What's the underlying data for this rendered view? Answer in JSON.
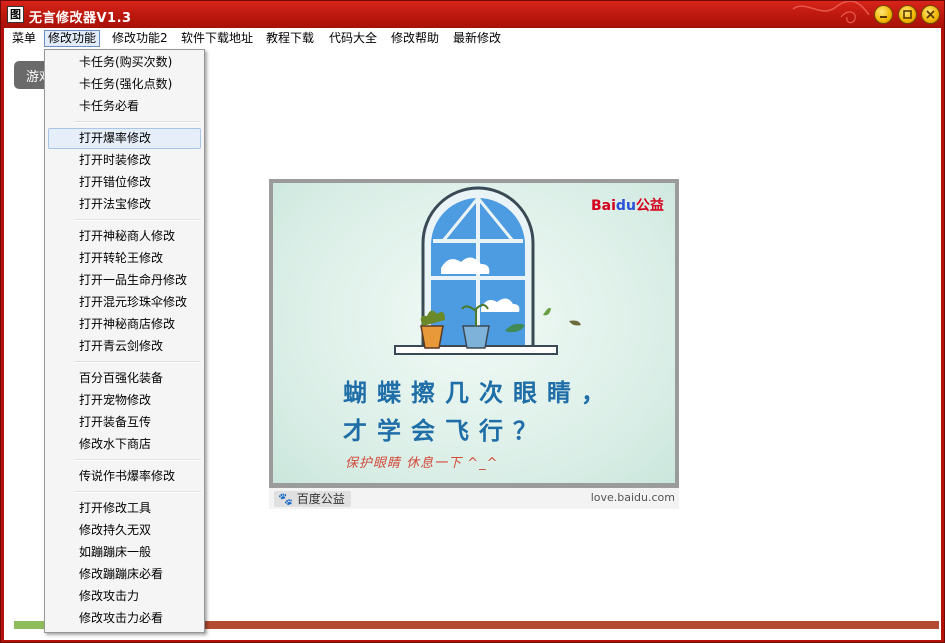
{
  "window": {
    "title": "无言修改器V1.3",
    "icon": "app-glyph-icon",
    "icon_glyph": "图"
  },
  "menubar": {
    "items": [
      "菜单",
      "修改功能",
      "修改功能2",
      "软件下载地址",
      "教程下载",
      "代码大全",
      "修改帮助",
      "最新修改"
    ],
    "active_index": 1
  },
  "background_tab": {
    "label": "游戏"
  },
  "dropdown": {
    "hover_index": 3,
    "items": [
      "卡任务(购买次数)",
      "卡任务(强化点数)",
      "卡任务必看",
      "打开爆率修改",
      "打开时装修改",
      "打开错位修改",
      "打开法宝修改",
      "打开神秘商人修改",
      "打开转轮王修改",
      "打开一品生命丹修改",
      "打开混元珍珠伞修改",
      "打开神秘商店修改",
      "打开青云剑修改",
      "百分百强化装备",
      "打开宠物修改",
      "打开装备互传",
      "修改水下商店",
      "传说作书爆率修改",
      "打开修改工具",
      "修改持久无双",
      "如蹦蹦床一般",
      "修改蹦蹦床必看",
      "修改攻击力",
      "修改攻击力必看"
    ]
  },
  "ad": {
    "brand": "Bai",
    "brand_paw": "du",
    "brand_suffix": "公益",
    "headline_1": "蝴蝶擦几次眼睛，",
    "headline_2": "才学会飞行？",
    "subline": "保护眼睛 休息一下 ^_^",
    "footer_tag": "百度公益",
    "footer_url": "love.baidu.com"
  },
  "progress": {
    "fraction": 0.034
  },
  "colors": {
    "titlebar": "#c01a10",
    "accent": "#b41208",
    "progress_fill": "#8fbc5a",
    "progress_track": "#b44a32"
  }
}
